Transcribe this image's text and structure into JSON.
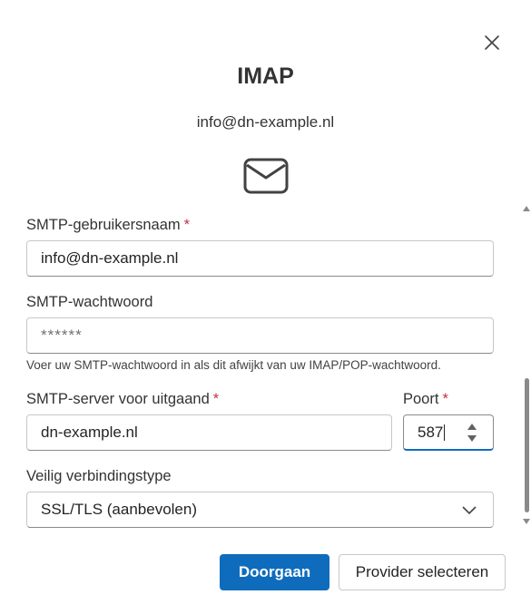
{
  "dialog": {
    "title": "IMAP",
    "account_email": "info@dn-example.nl",
    "close_icon": "close-icon",
    "mail_icon": "envelope-icon"
  },
  "form": {
    "smtp_username": {
      "label": "SMTP-gebruikersnaam",
      "required_mark": "*",
      "value": "info@dn-example.nl"
    },
    "smtp_password": {
      "label": "SMTP-wachtwoord",
      "placeholder": "******",
      "hint": "Voer uw SMTP-wachtwoord in als dit afwijkt van uw IMAP/POP-wachtwoord."
    },
    "smtp_server": {
      "label": "SMTP-server voor uitgaand",
      "required_mark": "*",
      "value": "dn-example.nl"
    },
    "port": {
      "label": "Poort",
      "required_mark": "*",
      "value": "587"
    },
    "security": {
      "label": "Veilig verbindingstype",
      "value": "SSL/TLS (aanbevolen)"
    }
  },
  "actions": {
    "continue_label": "Doorgaan",
    "select_provider_label": "Provider selecteren"
  },
  "colors": {
    "primary": "#0f6cbd",
    "required": "#c4314b"
  }
}
